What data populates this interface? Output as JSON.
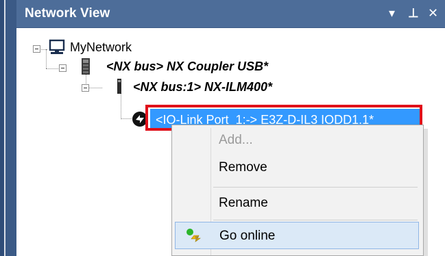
{
  "panel": {
    "title": "Network View",
    "dropdown_glyph": "▾",
    "pin_glyph": "⊥",
    "close_glyph": "✕"
  },
  "tree": {
    "root": {
      "label": "MyNetwork",
      "icon": "network-computer-icon"
    },
    "coupler": {
      "label": "<NX bus> NX Coupler USB*",
      "icon": "coupler-device-icon"
    },
    "ilm": {
      "label": "<NX bus:1> NX-ILM400*",
      "icon": "io-link-master-icon"
    },
    "port": {
      "label": "<IO-Link Port_1:-> E3Z-D-IL3 IODD1.1*",
      "icon": "io-link-sensor-icon"
    }
  },
  "context_menu": {
    "items": [
      {
        "label": "Add...",
        "enabled": false
      },
      {
        "label": "Remove",
        "enabled": true
      },
      {
        "label": "Rename",
        "enabled": true
      },
      {
        "label": "Go online",
        "enabled": true,
        "icon": "go-online-icon"
      }
    ]
  },
  "colors": {
    "titlebar": "#4d6d99",
    "selection": "#3399ff",
    "highlight_box": "#e0101a",
    "menu_background": "#f2f2f2",
    "menu_hover": "#dbe9f7"
  }
}
